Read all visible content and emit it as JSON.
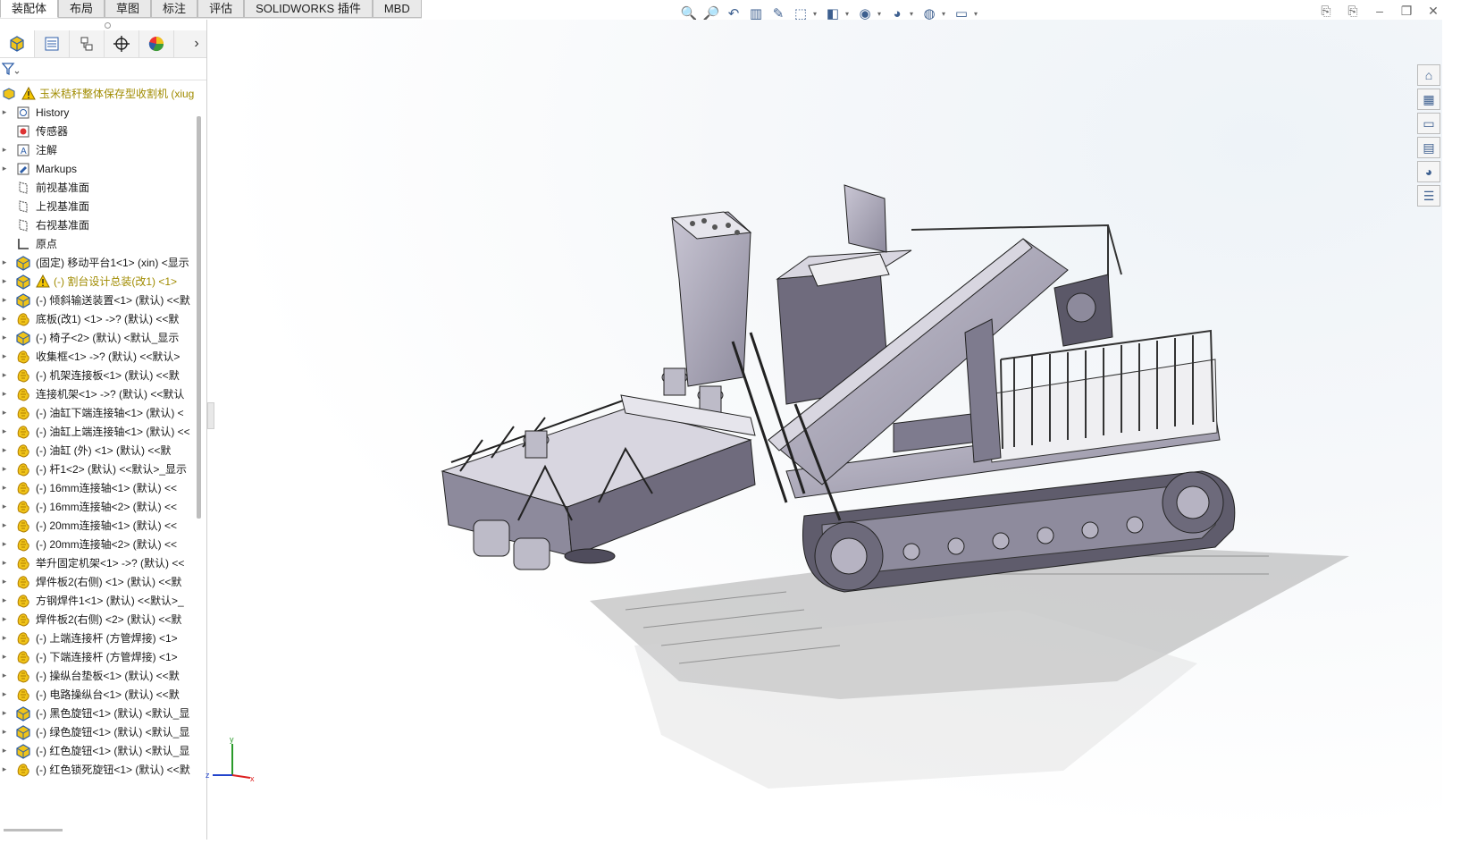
{
  "tabs": [
    "装配体",
    "布局",
    "草图",
    "标注",
    "评估",
    "SOLIDWORKS 插件",
    "MBD"
  ],
  "active_tab": 0,
  "heads_up_toolbar": [
    "zoom-to-fit-icon",
    "zoom-to-area-icon",
    "previous-view-icon",
    "section-view-icon",
    "dynamic-annotation-icon",
    "view-orientation-icon",
    "display-style-icon",
    "hide-show-icon",
    "edit-appearance-icon",
    "apply-scene-icon",
    "view-settings-icon"
  ],
  "window_controls": [
    "restore-left-icon",
    "restore-right-icon",
    "minimize-icon",
    "maximize-icon",
    "close-icon"
  ],
  "panel_tabs": [
    "featuremanager-icon",
    "propertymanager-icon",
    "configurationmanager-icon",
    "dimxpertmanager-icon",
    "displaymanager-icon"
  ],
  "tree": {
    "root": "玉米秸秆整体保存型收割机 (xiug",
    "items": [
      {
        "label": "History",
        "icon": "history",
        "expandable": true
      },
      {
        "label": "传感器",
        "icon": "sensor",
        "expandable": false
      },
      {
        "label": "注解",
        "icon": "annotation",
        "expandable": true
      },
      {
        "label": "Markups",
        "icon": "markup",
        "expandable": true
      },
      {
        "label": "前视基准面",
        "icon": "plane",
        "expandable": false
      },
      {
        "label": "上视基准面",
        "icon": "plane",
        "expandable": false
      },
      {
        "label": "右视基准面",
        "icon": "plane",
        "expandable": false
      },
      {
        "label": "原点",
        "icon": "origin",
        "expandable": false
      },
      {
        "label": "(固定) 移动平台1<1> (xin) <显示",
        "icon": "assembly",
        "expandable": true
      },
      {
        "label": "(-) 割台设计总装(改1) <1>",
        "icon": "assembly",
        "expandable": true,
        "warning": true
      },
      {
        "label": "(-) 倾斜输送装置<1> (默认) <<默",
        "icon": "assembly",
        "expandable": true
      },
      {
        "label": "底板(改1) <1> ->? (默认) <<默",
        "icon": "part",
        "expandable": true
      },
      {
        "label": "(-) 椅子<2> (默认) <默认_显示",
        "icon": "assembly",
        "expandable": true
      },
      {
        "label": "收集框<1> ->? (默认) <<默认>",
        "icon": "part",
        "expandable": true
      },
      {
        "label": "(-) 机架连接板<1> (默认) <<默",
        "icon": "part",
        "expandable": true
      },
      {
        "label": "连接机架<1> ->? (默认) <<默认",
        "icon": "part",
        "expandable": true
      },
      {
        "label": "(-) 油缸下端连接轴<1> (默认) <",
        "icon": "part",
        "expandable": true
      },
      {
        "label": "(-) 油缸上端连接轴<1> (默认) <<",
        "icon": "part",
        "expandable": true
      },
      {
        "label": "(-) 油缸 (外) <1> (默认) <<默",
        "icon": "part",
        "expandable": true
      },
      {
        "label": "(-) 杆1<2> (默认) <<默认>_显示",
        "icon": "part",
        "expandable": true
      },
      {
        "label": "(-) 16mm连接轴<1> (默认) <<",
        "icon": "part",
        "expandable": true
      },
      {
        "label": "(-) 16mm连接轴<2> (默认) <<",
        "icon": "part",
        "expandable": true
      },
      {
        "label": "(-) 20mm连接轴<1> (默认) <<",
        "icon": "part",
        "expandable": true
      },
      {
        "label": "(-) 20mm连接轴<2> (默认) <<",
        "icon": "part",
        "expandable": true
      },
      {
        "label": "举升固定机架<1> ->? (默认) <<",
        "icon": "part",
        "expandable": true
      },
      {
        "label": "焊件板2(右侧) <1> (默认) <<默",
        "icon": "part",
        "expandable": true
      },
      {
        "label": "方钢焊件1<1> (默认) <<默认>_",
        "icon": "part",
        "expandable": true
      },
      {
        "label": "焊件板2(右侧) <2> (默认) <<默",
        "icon": "part",
        "expandable": true
      },
      {
        "label": "(-) 上端连接杆 (方管焊接) <1>",
        "icon": "part",
        "expandable": true
      },
      {
        "label": "(-) 下端连接杆 (方管焊接) <1>",
        "icon": "part",
        "expandable": true
      },
      {
        "label": "(-) 操纵台垫板<1> (默认) <<默",
        "icon": "part",
        "expandable": true
      },
      {
        "label": "(-) 电路操纵台<1> (默认) <<默",
        "icon": "part",
        "expandable": true
      },
      {
        "label": "(-) 黑色旋钮<1> (默认) <默认_显",
        "icon": "assembly",
        "expandable": true
      },
      {
        "label": "(-) 绿色旋钮<1> (默认) <默认_显",
        "icon": "assembly",
        "expandable": true
      },
      {
        "label": "(-) 红色旋钮<1> (默认) <默认_显",
        "icon": "assembly",
        "expandable": true
      },
      {
        "label": "(-) 红色锁死旋钮<1> (默认) <<默",
        "icon": "part",
        "expandable": true
      }
    ]
  },
  "task_pane": [
    "home-icon",
    "design-library-icon",
    "file-explorer-icon",
    "view-palette-icon",
    "appearances-icon",
    "custom-properties-icon"
  ],
  "triad": {
    "x": "x",
    "y": "y",
    "z": "z"
  },
  "colors": {
    "model": "#a7a4b3",
    "model_dark": "#6f6b7d",
    "warning": "#a08b00",
    "part_icon": "#e0a800",
    "assembly_icon": "#3c6fb5"
  }
}
